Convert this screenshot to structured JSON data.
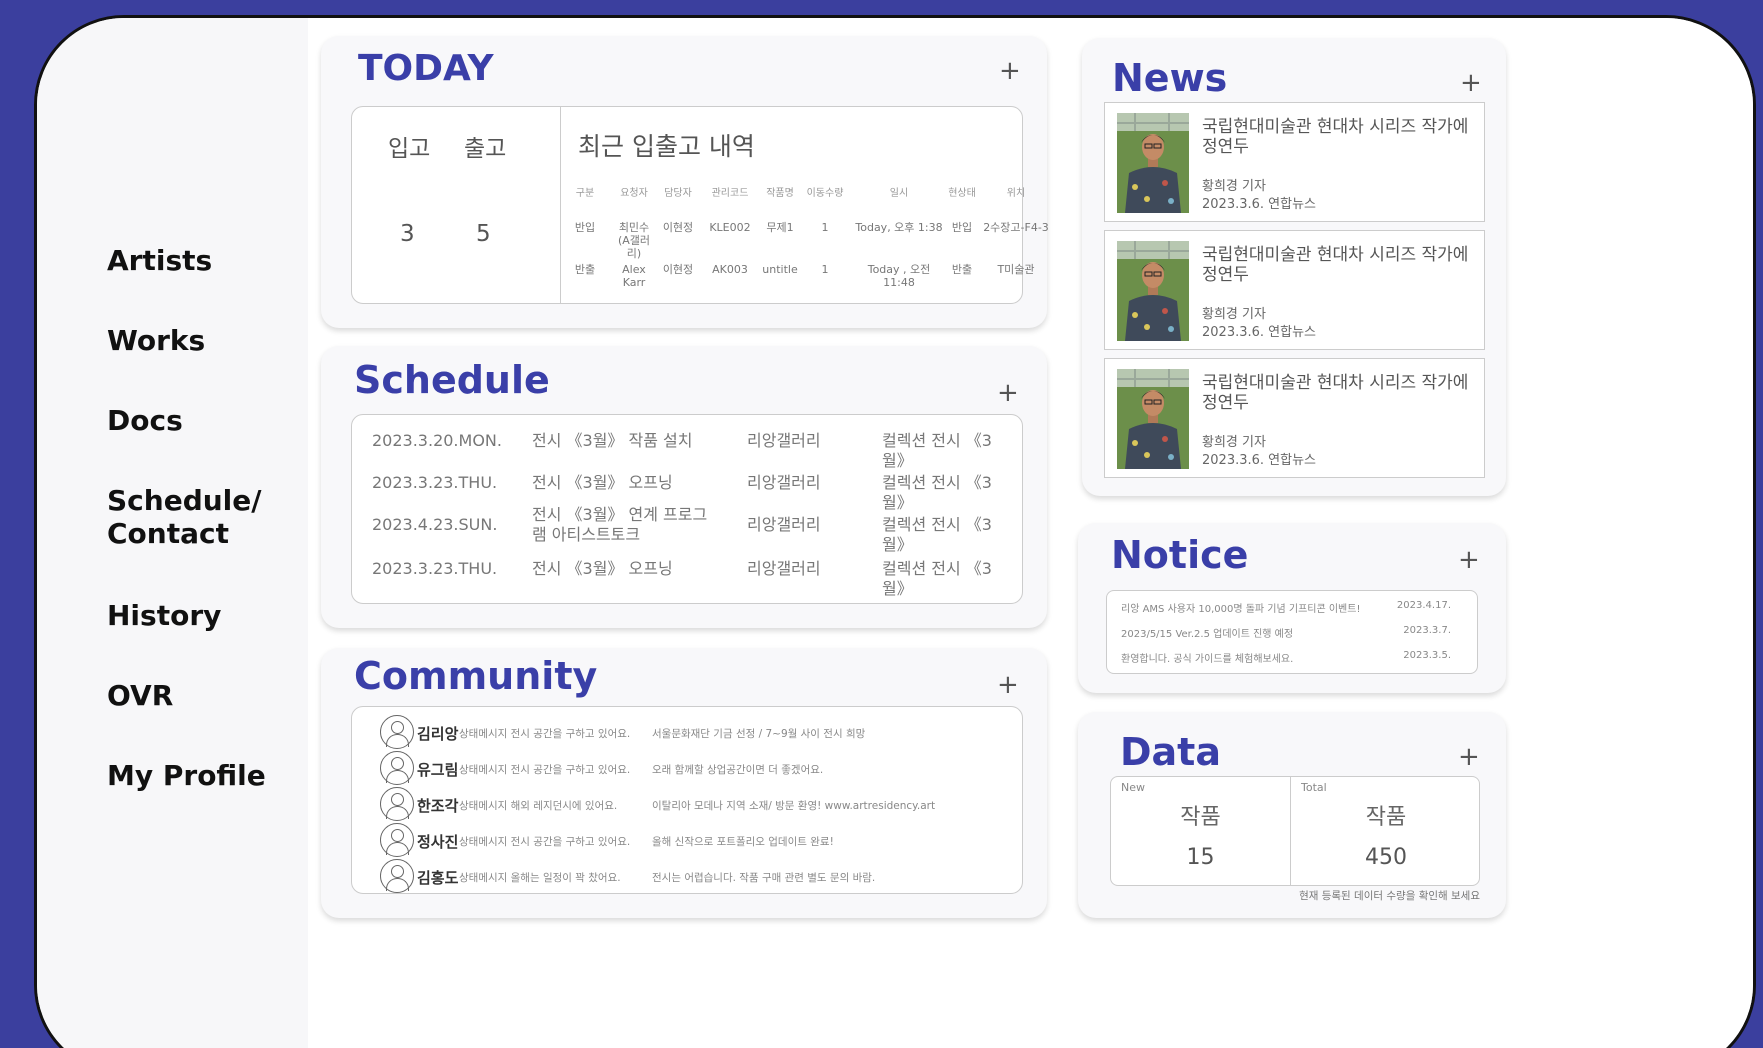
{
  "nav": [
    "Artists",
    "Works",
    "Docs",
    "Schedule/ Contact",
    "History",
    "OVR",
    "My Profile"
  ],
  "nav_lines": [
    [
      "Schedule/",
      "Contact"
    ]
  ],
  "today": {
    "title": "TODAY",
    "plus": "+",
    "in_label": "입고",
    "out_label": "출고",
    "in_value": "3",
    "out_value": "5",
    "recent_title": "최근 입출고 내역",
    "headers": [
      "구분",
      "요청자",
      "담당자",
      "관리코드",
      "작품명",
      "이동수량",
      "일시",
      "현상태",
      "위치"
    ],
    "rows": [
      [
        "반입",
        "최민수 (A갤러리)",
        "이현정",
        "KLE002",
        "무제1",
        "1",
        "Today, 오후 1:38",
        "반입",
        "2수장고-F4-3"
      ],
      [
        "반출",
        "Alex Karr",
        "이현정",
        "AK003",
        "untitle",
        "1",
        "Today , 오전 11:48",
        "반출",
        "T미술관"
      ]
    ]
  },
  "schedule": {
    "title": "Schedule",
    "plus": "+",
    "rows": [
      [
        "2023.3.20.MON.",
        "전시 《3월》 작품 설치",
        "리앙갤러리",
        "컬렉션 전시 《3월》"
      ],
      [
        "2023.3.23.THU.",
        "전시 《3월》 오프닝",
        "리앙갤러리",
        "컬렉션 전시 《3월》"
      ],
      [
        "2023.4.23.SUN.",
        "전시 《3월》 연계 프로그램 아티스트토크",
        "리앙갤러리",
        "컬렉션 전시 《3월》"
      ],
      [
        "2023.3.23.THU.",
        "전시 《3월》 오프닝",
        "리앙갤러리",
        "컬렉션 전시 《3월》"
      ]
    ]
  },
  "community": {
    "title": "Community",
    "plus": "+",
    "rows": [
      [
        "김리앙",
        "상태메시지 전시 공간을 구하고 있어요.",
        "서울문화재단 기금 선정 / 7~9월 사이 전시 희망"
      ],
      [
        "유그림",
        "상태메시지 전시 공간을 구하고 있어요.",
        "오래 함께할 상업공간이면 더 좋겠어요."
      ],
      [
        "한조각",
        "상태메시지 해외 레지던시에 있어요.",
        "이탈리아 모데나 지역 소재/ 방문 환영! www.artresidency.art"
      ],
      [
        "정사진",
        "상태메시지 전시 공간을 구하고 있어요.",
        "올해 신작으로 포트폴리오 업데이트 완료!"
      ],
      [
        "김홍도",
        "상태메시지 올해는 일정이 꽉 찼어요.",
        "전시는 어렵습니다. 작품 구매 관련 별도 문의 바람."
      ]
    ]
  },
  "news": {
    "title": "News",
    "plus": "+",
    "items": [
      {
        "title": "국립현대미술관 현대차 시리즈 작가에 정연두",
        "author": "황희경 기자",
        "date": "2023.3.6. 연합뉴스"
      },
      {
        "title": "국립현대미술관 현대차 시리즈 작가에 정연두",
        "author": "황희경 기자",
        "date": "2023.3.6. 연합뉴스"
      },
      {
        "title": "국립현대미술관 현대차 시리즈 작가에 정연두",
        "author": "황희경 기자",
        "date": "2023.3.6. 연합뉴스"
      }
    ]
  },
  "notice": {
    "title": "Notice",
    "plus": "+",
    "rows": [
      [
        "리앙 AMS 사용자 10,000명 돌파 기념 기프티콘 이벤트!",
        "2023.4.17."
      ],
      [
        "2023/5/15 Ver.2.5 업데이트 진행 예정",
        "2023.3.7."
      ],
      [
        "환영합니다. 공식 가이드를 체험해보세요.",
        "2023.3.5."
      ]
    ]
  },
  "data": {
    "title": "Data",
    "plus": "+",
    "new_label": "New",
    "total_label": "Total",
    "new_kind": "작품",
    "total_kind": "작품",
    "new_value": "15",
    "total_value": "450",
    "footnote": "현재 등록된 데이터 수량을 확인해 보세요"
  }
}
